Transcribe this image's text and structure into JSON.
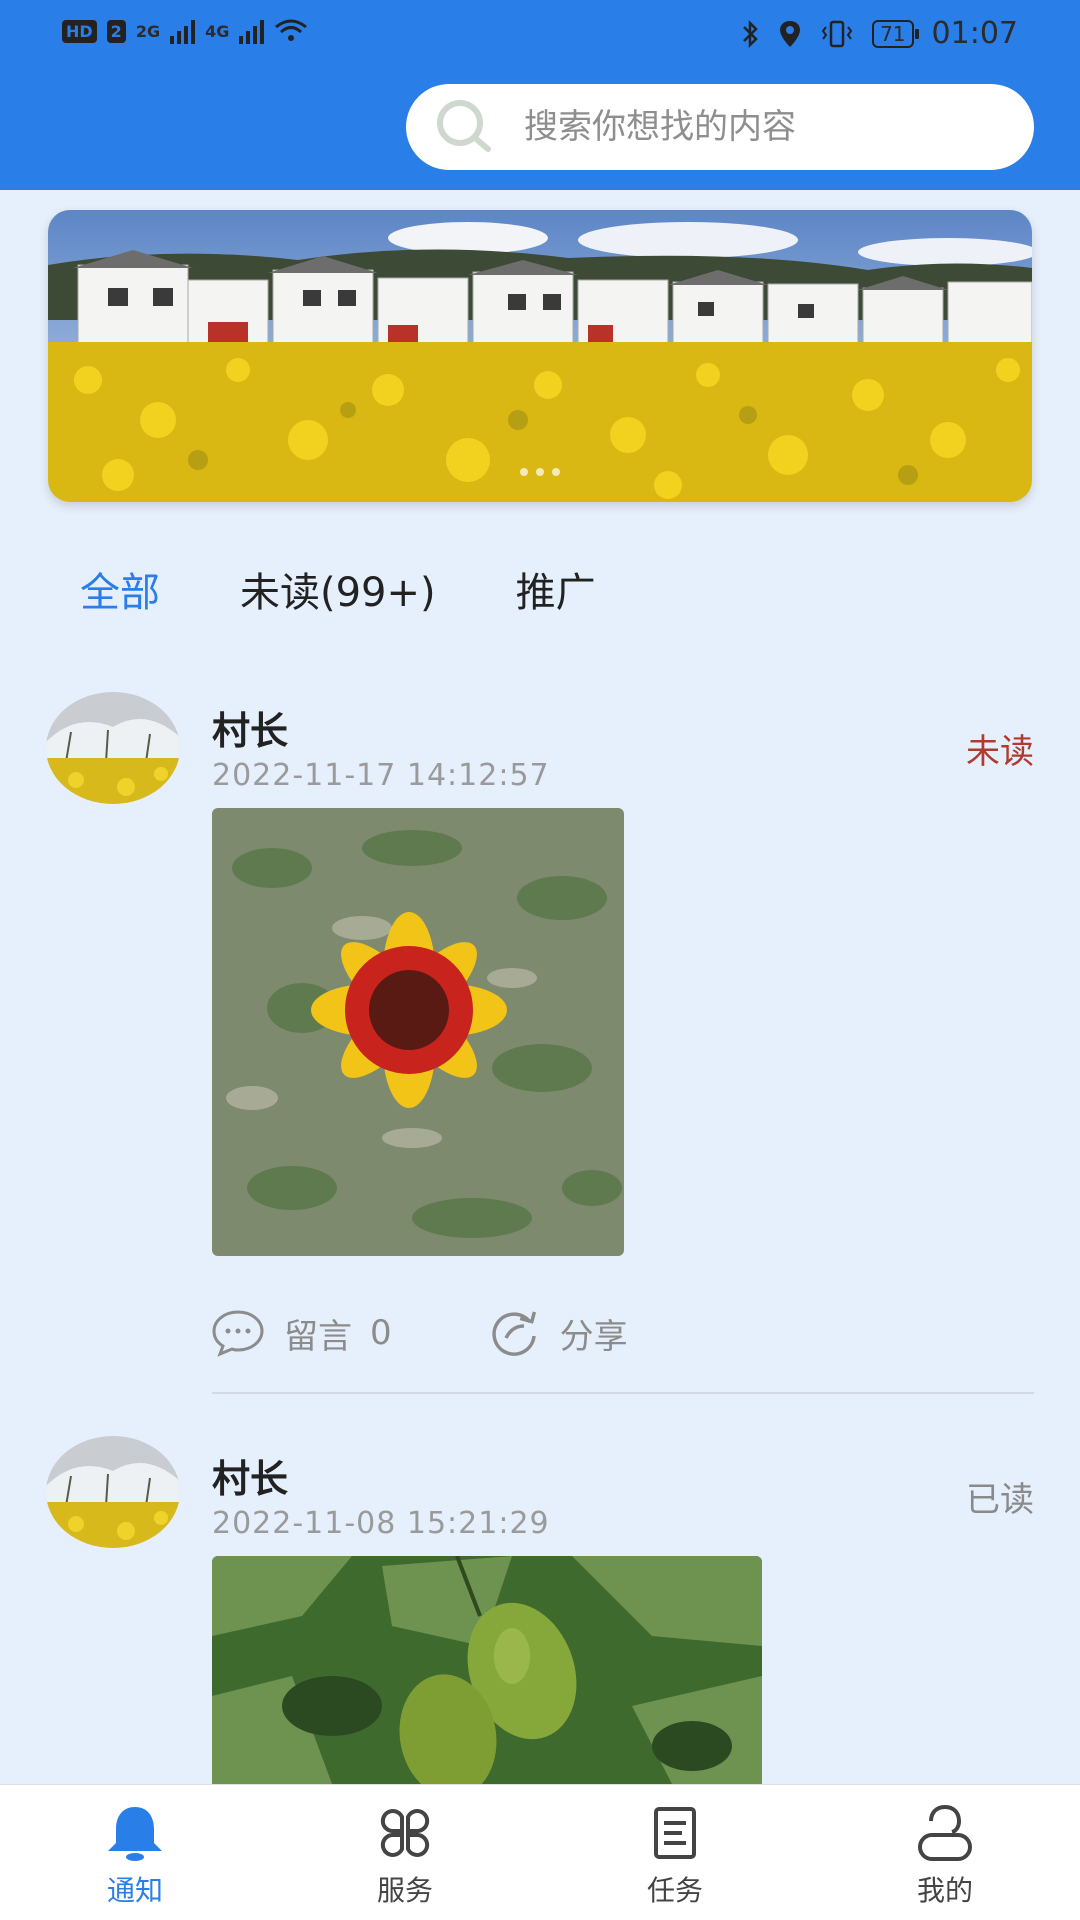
{
  "status_bar": {
    "hd_badge": "HD",
    "sim_badge": "2",
    "net1": "2G",
    "net2": "4G",
    "battery": "71",
    "time": "01:07"
  },
  "search": {
    "placeholder": "搜索你想找的内容"
  },
  "tabs": [
    {
      "label": "全部",
      "active": true
    },
    {
      "label": "未读(99+)",
      "active": false
    },
    {
      "label": "推广",
      "active": false
    }
  ],
  "posts": [
    {
      "author": "村长",
      "time": "2022-11-17 14:12:57",
      "status": "未读",
      "comment_label": "留言",
      "comment_count": "0",
      "share_label": "分享"
    },
    {
      "author": "村长",
      "time": "2022-11-08 15:21:29",
      "status": "已读"
    }
  ],
  "bottom_nav": [
    {
      "label": "通知",
      "icon": "bell-icon",
      "active": true
    },
    {
      "label": "服务",
      "icon": "grid-icon",
      "active": false
    },
    {
      "label": "任务",
      "icon": "document-icon",
      "active": false
    },
    {
      "label": "我的",
      "icon": "user-icon",
      "active": false
    }
  ],
  "colors": {
    "accent": "#2a7ee8",
    "unread": "#b03a2e",
    "background": "#e6f0fc"
  }
}
